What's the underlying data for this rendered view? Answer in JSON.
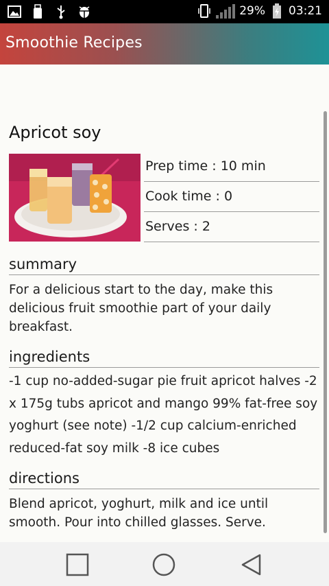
{
  "status_bar": {
    "battery_percent": "29%",
    "time": "03:21",
    "icons": [
      "image-icon",
      "usb-drive-icon",
      "usb-icon",
      "android-debug-icon",
      "vibrate-icon",
      "signal-icon",
      "battery-charging-icon"
    ]
  },
  "app_bar": {
    "title": "Smoothie Recipes"
  },
  "recipe": {
    "title": "Apricot soy",
    "image_alt": "apricot soy smoothies",
    "prep_time": "Prep time : 10 min",
    "cook_time": "Cook time : 0",
    "serves": "Serves : 2"
  },
  "summary": {
    "heading": "summary",
    "text": "For a delicious start to the day, make this delicious fruit smoothie part of your daily breakfast."
  },
  "ingredients": {
    "heading": "ingredients",
    "text": "-1 cup no-added-sugar pie fruit apricot halves -2 x 175g tubs apricot and mango 99% fat-free soy yoghurt (see note) -1/2 cup calcium-enriched reduced-fat soy milk -8 ice cubes"
  },
  "directions": {
    "heading": "directions",
    "text": "Blend apricot, yoghurt, milk and ice until smooth. Pour into chilled glasses. Serve."
  },
  "nav_bar": {
    "buttons": [
      "recent-apps-button",
      "home-button",
      "back-button"
    ]
  },
  "colors": {
    "app_bar_start": "#c4443d",
    "app_bar_end": "#1e9296",
    "image_background": "#c8265a"
  }
}
